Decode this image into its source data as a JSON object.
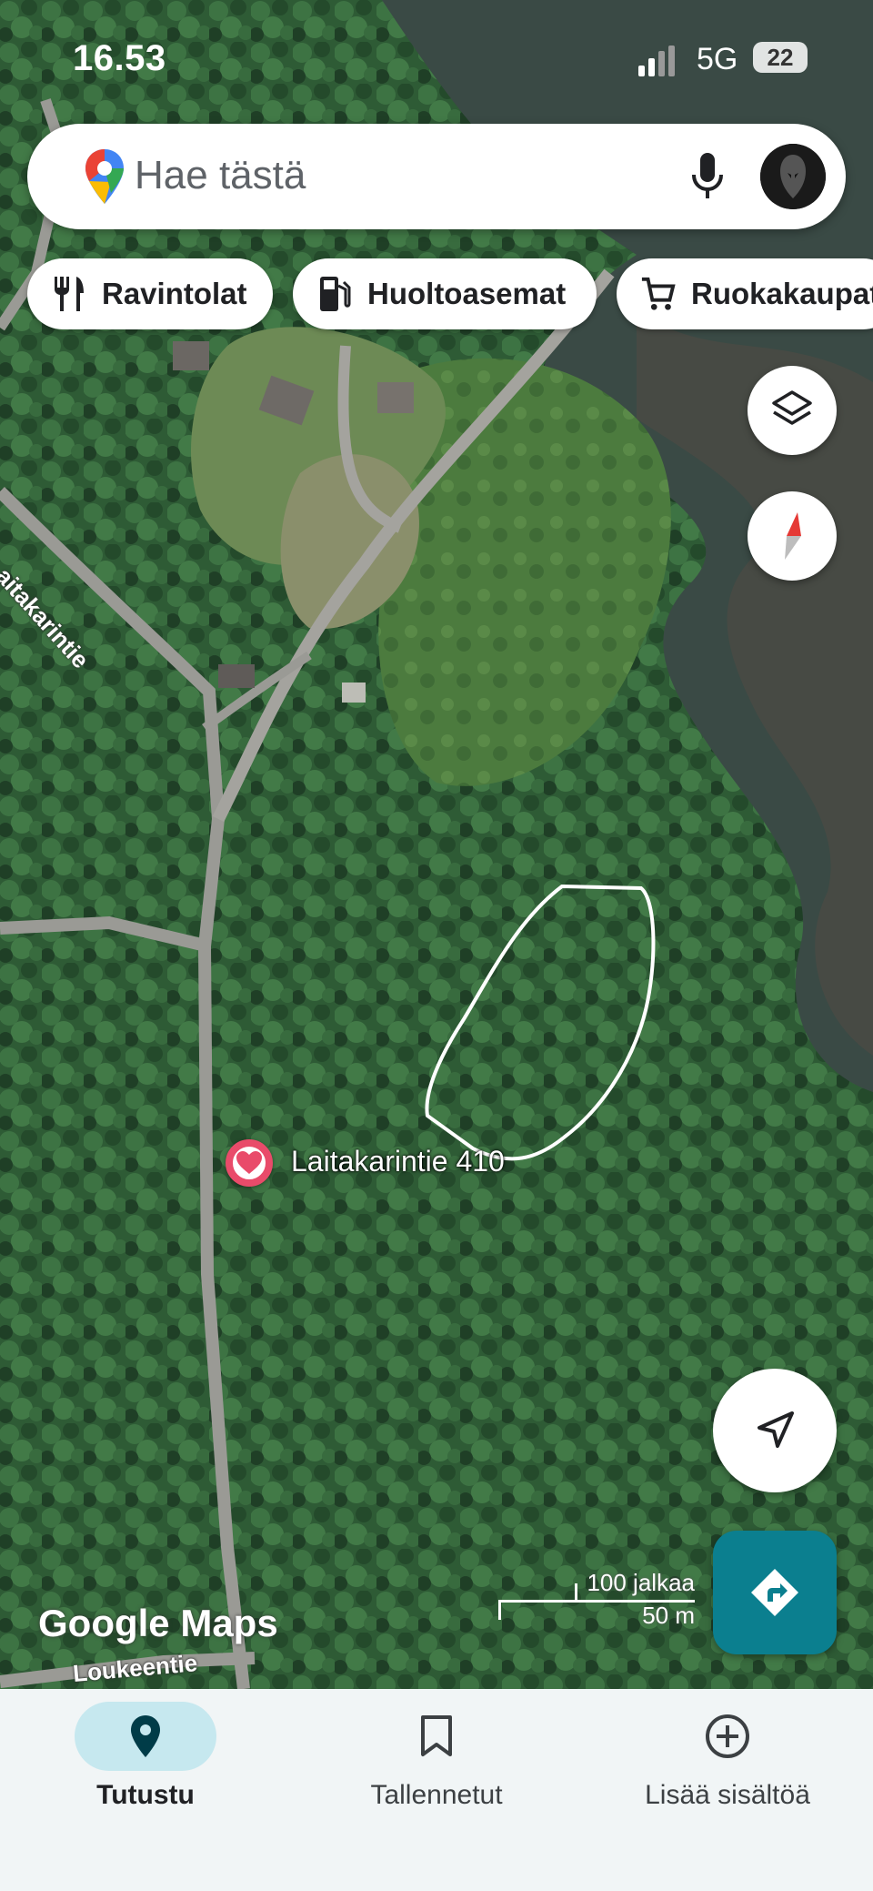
{
  "status_bar": {
    "time": "16.53",
    "network": "5G",
    "battery": "22"
  },
  "search": {
    "placeholder": "Hae tästä"
  },
  "chips": [
    {
      "label": "Ravintolat",
      "icon": "restaurant-icon"
    },
    {
      "label": "Huoltoasemat",
      "icon": "gas-station-icon"
    },
    {
      "label": "Ruokakaupat",
      "icon": "shopping-cart-icon"
    }
  ],
  "map": {
    "saved_place": "Laitakarintie 410",
    "road_labels": [
      "aitakarintie",
      "Loukeentie"
    ],
    "logo": "Google Maps",
    "scale": {
      "imperial": "100 jalkaa",
      "metric": "50 m"
    }
  },
  "buttons": {
    "layers": "layers-icon",
    "compass": "compass-icon",
    "my_location": "navigation-arrow-icon",
    "directions": "directions-icon"
  },
  "bottom_nav": [
    {
      "label": "Tutustu",
      "icon": "location-pin-icon",
      "active": true
    },
    {
      "label": "Tallennetut",
      "icon": "bookmark-icon",
      "active": false
    },
    {
      "label": "Lisää sisältöä",
      "icon": "add-circle-icon",
      "active": false
    }
  ],
  "colors": {
    "accent": "#0b7f8f",
    "saved_pin": "#e94b6a",
    "nav_active_bg": "#c6e8ef"
  }
}
